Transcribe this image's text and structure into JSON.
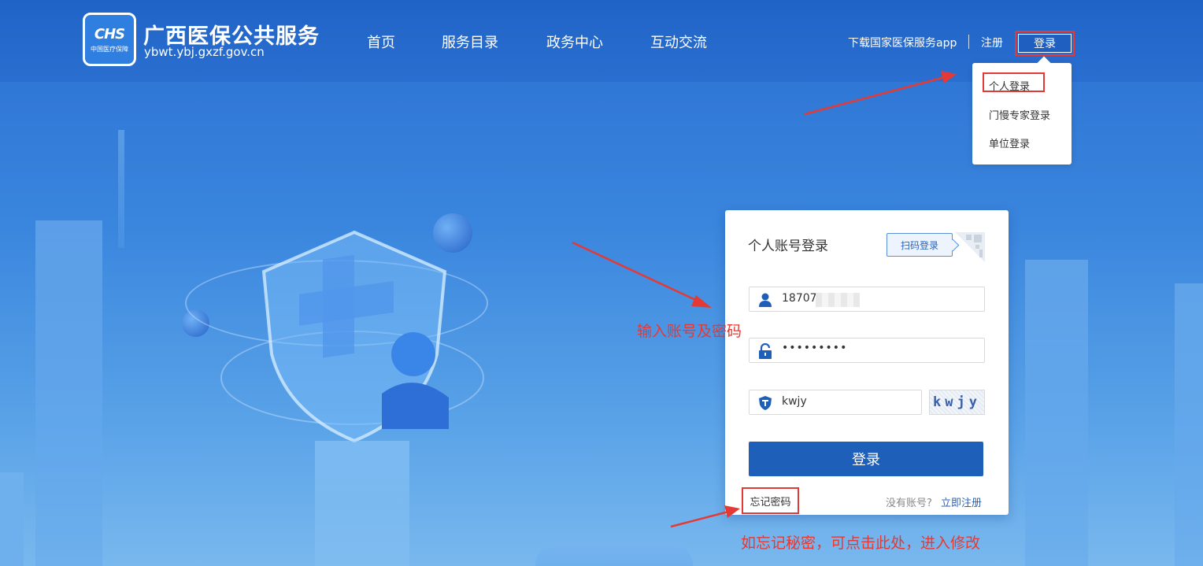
{
  "header": {
    "logo_mark": "CHS",
    "logo_sub": "中国医疗保障",
    "site_name": "广西医保公共服务",
    "site_url": "ybwt.ybj.gxzf.gov.cn",
    "nav": [
      "首页",
      "服务目录",
      "政务中心",
      "互动交流"
    ],
    "download_app": "下载国家医保服务app",
    "register": "注册",
    "login": "登录"
  },
  "dropdown": {
    "items": [
      "个人登录",
      "门慢专家登录",
      "单位登录"
    ]
  },
  "login_card": {
    "title": "个人账号登录",
    "scan_login": "扫码登录",
    "account_value": "18707",
    "password_value": "•••••••••",
    "captcha_value": "kwjy",
    "captcha_image_text": "kwjy",
    "submit": "登录",
    "forgot": "忘记密码",
    "no_account": "没有账号?",
    "register_now": "立即注册"
  },
  "annotations": {
    "input_hint": "输入账号及密码",
    "forgot_hint": "如忘记秘密，可点击此处，进入修改"
  },
  "colors": {
    "primary": "#1e5fb9",
    "annotation_red": "#e53935"
  }
}
